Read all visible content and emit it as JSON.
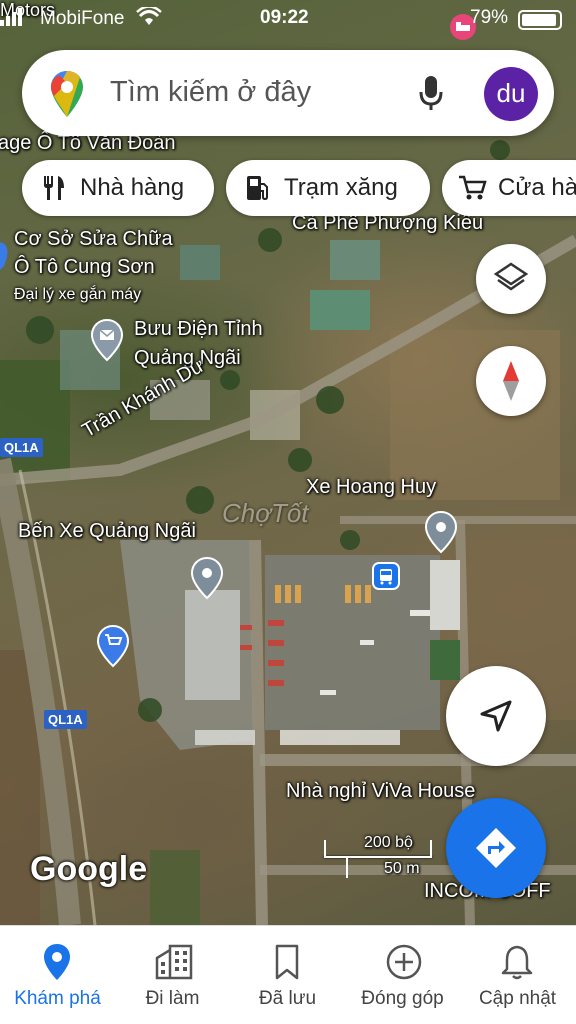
{
  "status_bar": {
    "carrier": "MobiFone",
    "time": "09:22",
    "battery": "79%"
  },
  "search": {
    "placeholder": "Tìm kiếm ở đây",
    "avatar_initials": "du"
  },
  "chips": [
    {
      "label": "Nhà hàng",
      "icon": "restaurant-icon"
    },
    {
      "label": "Trạm xăng",
      "icon": "gas-station-icon"
    },
    {
      "label": "Cửa hà",
      "icon": "shopping-cart-icon"
    }
  ],
  "map": {
    "labels": {
      "motors": "Motors",
      "garage": "age Ô Tô Văn Đoàn",
      "ca_phe": "Cà Phê Phượng Kiều",
      "co_so": "Cơ Sở Sửa Chữa",
      "oto_cung_son": "Ô Tô Cung Sơn",
      "dai_ly": "Đại lý xe gắn máy",
      "buu_dien_1": "Bưu Điện Tỉnh",
      "buu_dien_2": "Quảng Ngãi",
      "tran_khanh_du": "Trần Khánh Dư",
      "xe_hoang_huy": "Xe Hoang Huy",
      "ben_xe": "Bến Xe Quảng Ngãi",
      "nha_nghi": "Nhà nghỉ ViVa House",
      "incom": "INCOM COFF",
      "ql1a_top": "QL1A",
      "ql1a": "QL1A",
      "watermark": "ChợTốt"
    },
    "scale": {
      "feet": "200 bộ",
      "meters": "50 m"
    },
    "google_logo": "Google"
  },
  "nav": [
    {
      "label": "Khám phá",
      "icon": "explore-pin-icon",
      "active": true
    },
    {
      "label": "Đi làm",
      "icon": "commute-icon",
      "active": false
    },
    {
      "label": "Đã lưu",
      "icon": "bookmark-icon",
      "active": false
    },
    {
      "label": "Đóng góp",
      "icon": "add-circle-icon",
      "active": false
    },
    {
      "label": "Cập nhật",
      "icon": "bell-icon",
      "active": false
    }
  ],
  "colors": {
    "accent": "#1a73e8",
    "avatar": "#5c22a6",
    "directions": "#1a73e8"
  }
}
